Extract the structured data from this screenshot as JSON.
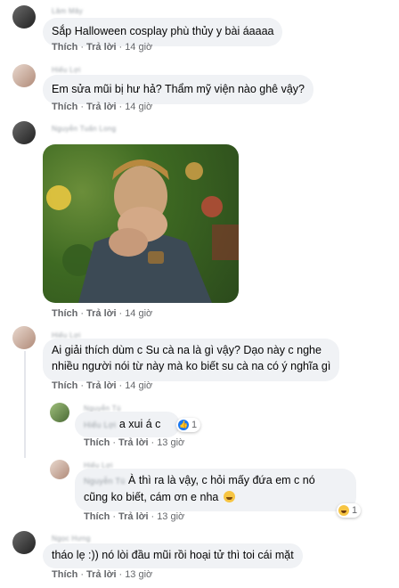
{
  "comments": [
    {
      "id": "c1",
      "name": "Lâm Mây",
      "text_lines": [
        "Sắp Halloween cosplay phù thủy y bài áaaaa"
      ],
      "actions": {
        "like": "Thích",
        "reply": "Trả lời",
        "time": "14 giờ"
      }
    },
    {
      "id": "c2",
      "name": "Hiếu Lợi",
      "text_lines": [
        "Em sửa mũi bị hư hả? Thẩm mỹ viện nào ghê vậy?"
      ],
      "actions": {
        "like": "Thích",
        "reply": "Trả lời",
        "time": "14 giờ"
      }
    },
    {
      "id": "c3",
      "name": "Nguyễn Tuấn Long",
      "media": "laughing-gif",
      "actions": {
        "like": "Thích",
        "reply": "Trả lời",
        "time": "14 giờ"
      }
    },
    {
      "id": "c4",
      "name": "Hiếu Lợi",
      "text_lines": [
        "Ai giải thích dùm c Su cà na là gì vậy? Dạo này c nghe",
        "nhiều người nói từ này mà ko biết su cà na có ý nghĩa gì"
      ],
      "actions": {
        "like": "Thích",
        "reply": "Trả lời",
        "time": "14 giờ"
      }
    },
    {
      "id": "r1",
      "name": "Nguyễn Tú",
      "tag": "Hiếu Lợi",
      "text_lines": [
        "a xui á c"
      ],
      "reaction": {
        "icon": "like-icon",
        "count": "1"
      },
      "actions": {
        "like": "Thích",
        "reply": "Trả lời",
        "time": "13 giờ"
      }
    },
    {
      "id": "r2",
      "name": "Hiếu Lợi",
      "tag": "Nguyễn Tú",
      "text_lines": [
        "À thì ra là vậy, c hỏi mấy đứa em c nó",
        "cũng ko biết, cám ơn e nha"
      ],
      "reaction": {
        "icon": "haha-icon",
        "count": "1"
      },
      "actions": {
        "like": "Thích",
        "reply": "Trả lời",
        "time": "13 giờ"
      }
    },
    {
      "id": "c5",
      "name": "Ngọc Hưng",
      "text_lines": [
        "tháo lẹ :)) nó lòi đầu mũi rồi hoại tử thì toi cái mặt"
      ],
      "actions": {
        "like": "Thích",
        "reply": "Trả lời",
        "time": "13 giờ"
      }
    }
  ],
  "colors": {
    "bubble": "#f0f2f5",
    "meta": "#65676b",
    "like_blue": "#1877f2"
  }
}
